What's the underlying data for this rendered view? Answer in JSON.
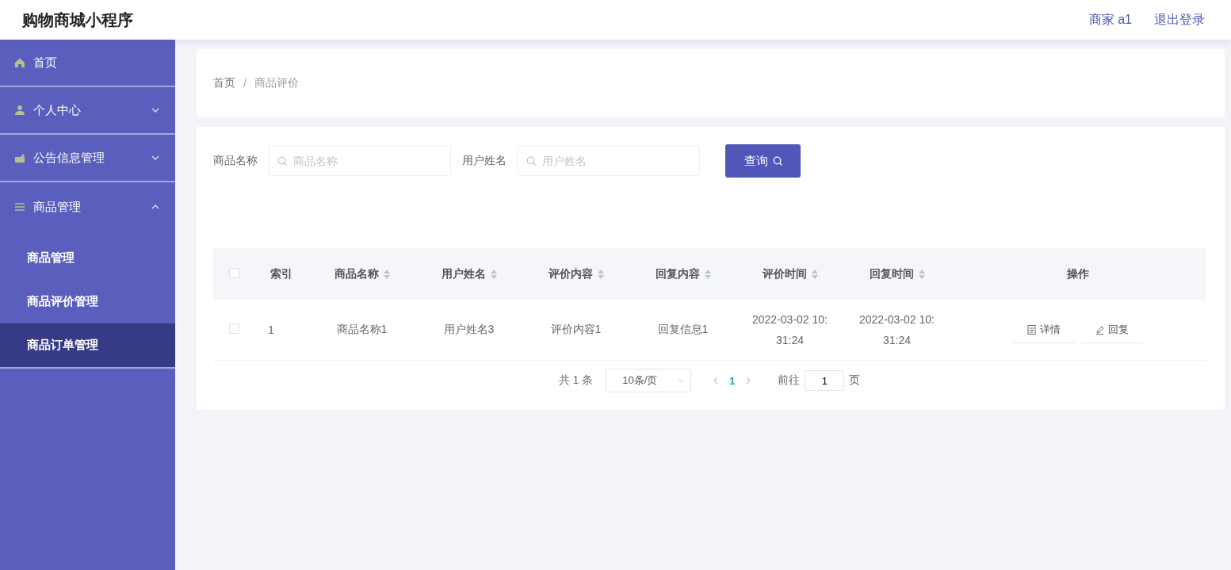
{
  "header": {
    "title": "购物商城小程序",
    "user_label": "商家 a1",
    "logout": "退出登录"
  },
  "sidebar": {
    "items": [
      {
        "label": "首页",
        "selected": false
      },
      {
        "label": "个人中心",
        "selected": false,
        "expanded": false
      },
      {
        "label": "公告信息管理",
        "selected": false,
        "expanded": false
      },
      {
        "label": "商品管理",
        "selected": false,
        "expanded": true,
        "children": [
          {
            "label": "商品管理",
            "selected": false
          },
          {
            "label": "商品评价管理",
            "selected": false
          },
          {
            "label": "商品订单管理",
            "selected": true
          }
        ]
      }
    ]
  },
  "breadcrumb": [
    "首页",
    "商品评价"
  ],
  "breadcrumb_separator": "/",
  "search": {
    "fields": [
      {
        "label": "商品名称",
        "placeholder": "商品名称"
      },
      {
        "label": "用户姓名",
        "placeholder": "用户姓名"
      }
    ],
    "button": "查询"
  },
  "table": {
    "all_checked": false,
    "columns": [
      {
        "label": "索引",
        "sortable": false
      },
      {
        "label": "商品名称",
        "sortable": true
      },
      {
        "label": "用户姓名",
        "sortable": true
      },
      {
        "label": "评价内容",
        "sortable": true
      },
      {
        "label": "回复内容",
        "sortable": true
      },
      {
        "label": "评价时间",
        "sortable": true
      },
      {
        "label": "回复时间",
        "sortable": true
      },
      {
        "label": "操作",
        "sortable": false
      }
    ],
    "rows": [
      {
        "checked": false,
        "cells": [
          "1",
          "商品名称1",
          "用户姓名3",
          "评价内容1",
          "回复信息1",
          "2022-03-02 10:31:24",
          "2022-03-02 10:31:24"
        ],
        "actions": [
          "详情",
          "回复"
        ]
      }
    ]
  },
  "pagination": {
    "total": "共 1 条",
    "page_size": "10条/页",
    "pages": [
      {
        "label": "1",
        "selected": true
      }
    ],
    "goto_label": "前往",
    "goto_value": "1",
    "goto_suffix": "页"
  }
}
